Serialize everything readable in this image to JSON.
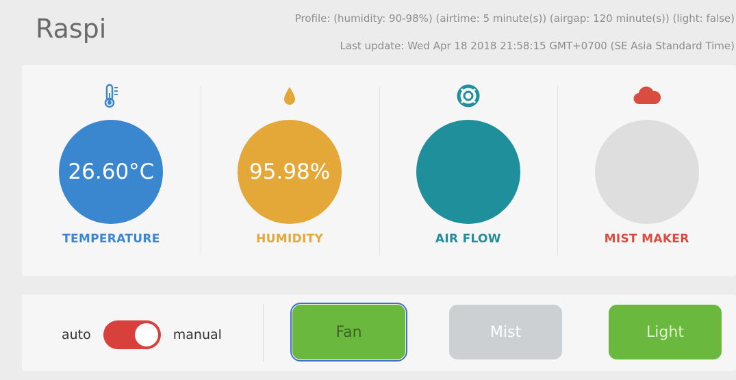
{
  "app": {
    "title": "Raspi",
    "profile": "Profile: (humidity: 90-98%) (airtime: 5 minute(s)) (airgap: 120 minute(s)) (light: false)",
    "last_update": "Last update: Wed Apr 18 2018 21:58:15 GMT+0700 (SE Asia Standard Time)"
  },
  "sensors": [
    {
      "key": "temperature",
      "label": "TEMPERATURE",
      "value": "26.60°C",
      "icon": "thermometer-icon",
      "color": "#3a87cf",
      "label_color": "#3a87cf"
    },
    {
      "key": "humidity",
      "label": "HUMIDITY",
      "value": "95.98%",
      "icon": "water-drop-icon",
      "color": "#e4a838",
      "label_color": "#e4a838"
    },
    {
      "key": "airflow",
      "label": "AIR FLOW",
      "value": "",
      "icon": "lifebuoy-icon",
      "color": "#1f8f9c",
      "label_color": "#1f8f9c"
    },
    {
      "key": "mist",
      "label": "MIST MAKER",
      "value": "",
      "icon": "cloud-icon",
      "color": "#dedede",
      "label_color": "#d84d40"
    }
  ],
  "controls": {
    "mode_left": "auto",
    "mode_right": "manual",
    "mode_state": "manual",
    "toggle_color": "#d8413b",
    "buttons": [
      {
        "key": "fan",
        "label": "Fan",
        "active": true,
        "bg": "#6ab83d",
        "fg": "#3f5f2a"
      },
      {
        "key": "mist",
        "label": "Mist",
        "active": false,
        "bg": "#cdd0d2",
        "fg": "#ffffff"
      },
      {
        "key": "light",
        "label": "Light",
        "active": true,
        "bg": "#6ab83d",
        "fg": "#dff0cf"
      }
    ]
  }
}
